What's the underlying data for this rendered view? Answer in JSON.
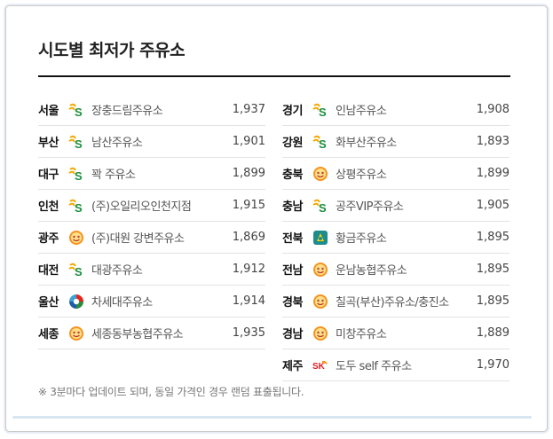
{
  "title": "시도별 최저가 주유소",
  "footnote": "※ 3분마다 업데이트 되며, 동일 가격인 경우 랜덤 표출됩니다.",
  "left_column": [
    {
      "region": "서울",
      "brand": "s-oil-logo",
      "station": "장충드림주유소",
      "price": "1,937"
    },
    {
      "region": "부산",
      "brand": "s-oil-logo",
      "station": "남산주유소",
      "price": "1,901"
    },
    {
      "region": "대구",
      "brand": "s-oil-logo",
      "station": "꽉 주유소",
      "price": "1,899"
    },
    {
      "region": "인천",
      "brand": "s-oil-logo",
      "station": "(주)오일리오인천지점",
      "price": "1,915"
    },
    {
      "region": "광주",
      "brand": "gs-caltex-logo",
      "station": "(주)대원 강변주유소",
      "price": "1,869"
    },
    {
      "region": "대전",
      "brand": "s-oil-logo",
      "station": "대광주유소",
      "price": "1,912"
    },
    {
      "region": "울산",
      "brand": "hyundai-oilbank-logo",
      "station": "차세대주유소",
      "price": "1,914"
    },
    {
      "region": "세종",
      "brand": "gs-caltex-logo",
      "station": "세종동부농협주유소",
      "price": "1,935"
    }
  ],
  "right_column": [
    {
      "region": "경기",
      "brand": "s-oil-logo",
      "station": "인남주유소",
      "price": "1,908"
    },
    {
      "region": "강원",
      "brand": "s-oil-logo",
      "station": "화부산주유소",
      "price": "1,893"
    },
    {
      "region": "충북",
      "brand": "gs-caltex-logo",
      "station": "상평주유소",
      "price": "1,899"
    },
    {
      "region": "충남",
      "brand": "s-oil-logo",
      "station": "공주VIP주유소",
      "price": "1,905"
    },
    {
      "region": "전북",
      "brand": "nh-logo",
      "station": "황금주유소",
      "price": "1,895"
    },
    {
      "region": "전남",
      "brand": "gs-caltex-logo",
      "station": "운남농협주유소",
      "price": "1,895"
    },
    {
      "region": "경북",
      "brand": "gs-caltex-logo",
      "station": "칠곡(부산)주유소/충진소",
      "price": "1,895"
    },
    {
      "region": "경남",
      "brand": "gs-caltex-logo",
      "station": "미창주유소",
      "price": "1,889"
    },
    {
      "region": "제주",
      "brand": "sk-logo",
      "station": "도두 self 주유소",
      "price": "1,970"
    }
  ]
}
